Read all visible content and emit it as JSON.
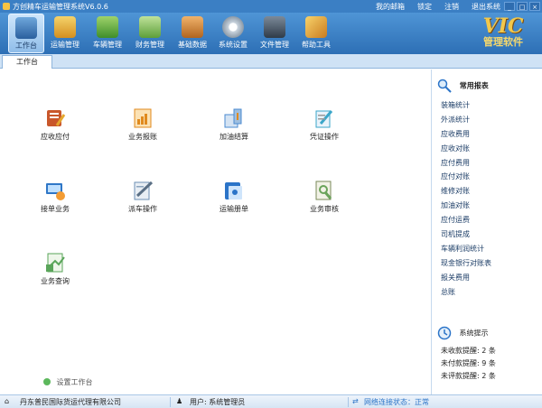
{
  "window": {
    "title": "方创精车运输管理系统V6.0.6",
    "menu": [
      "我的邮箱",
      "锁定",
      "注销",
      "退出系统"
    ],
    "controls": [
      "_",
      "□",
      "×"
    ]
  },
  "toolbar": {
    "items": [
      {
        "label": "工作台",
        "icon": "desk-icon"
      },
      {
        "label": "运输管理",
        "icon": "boxes-icon"
      },
      {
        "label": "车辆管理",
        "icon": "truck-icon"
      },
      {
        "label": "财务管理",
        "icon": "money-icon"
      },
      {
        "label": "基础数据",
        "icon": "cabinet-icon"
      },
      {
        "label": "系统设置",
        "icon": "gear-icon"
      },
      {
        "label": "文件管理",
        "icon": "file-icon"
      },
      {
        "label": "帮助工具",
        "icon": "tools-icon"
      }
    ],
    "logo_text": "VIC",
    "logo_subtitle": "管理软件"
  },
  "tabs": {
    "active": "工作台"
  },
  "workspace": {
    "apps": [
      {
        "label": "应收应付",
        "icon": "ledger-icon",
        "color": "#c9572b"
      },
      {
        "label": "业务报账",
        "icon": "report-icon",
        "color": "#e08a1e"
      },
      {
        "label": "加油结算",
        "icon": "fuel-icon",
        "color": "#4b8bd0"
      },
      {
        "label": "凭证操作",
        "icon": "voucher-icon",
        "color": "#3aa6c9"
      },
      {
        "label": "接单业务",
        "icon": "order-icon",
        "color": "#2f77c7"
      },
      {
        "label": "派车操作",
        "icon": "dispatch-icon",
        "color": "#6b8fb3"
      },
      {
        "label": "运输册单",
        "icon": "list-icon",
        "color": "#2b74c8"
      },
      {
        "label": "业务审核",
        "icon": "audit-icon",
        "color": "#6aa35a"
      },
      {
        "label": "业务查询",
        "icon": "query-icon",
        "color": "#5aa55a"
      }
    ],
    "settings_label": "设置工作台"
  },
  "sidebar": {
    "reports_title": "常用报表",
    "reports": [
      "装箱统计",
      "外派统计",
      "应收费用",
      "应收对账",
      "应付费用",
      "应付对账",
      "维修对账",
      "加油对账",
      "应付运费",
      "司机提成",
      "车辆利润统计",
      "现金银行对账表",
      "报关费用",
      "总账"
    ],
    "alerts_title": "系统提示",
    "alerts": [
      "未收款提醒: 2 条",
      "未付款提醒: 9 条",
      "未评款提醒: 2 条"
    ]
  },
  "status": {
    "company": "丹东普民国际货运代理有限公司",
    "user": "用户: 系统管理员",
    "network": "网络连接状态：正常"
  },
  "colors": {
    "title_bar": "#3b7fc4",
    "toolbar": "#2d6fb5",
    "accent": "#f2c84b"
  }
}
